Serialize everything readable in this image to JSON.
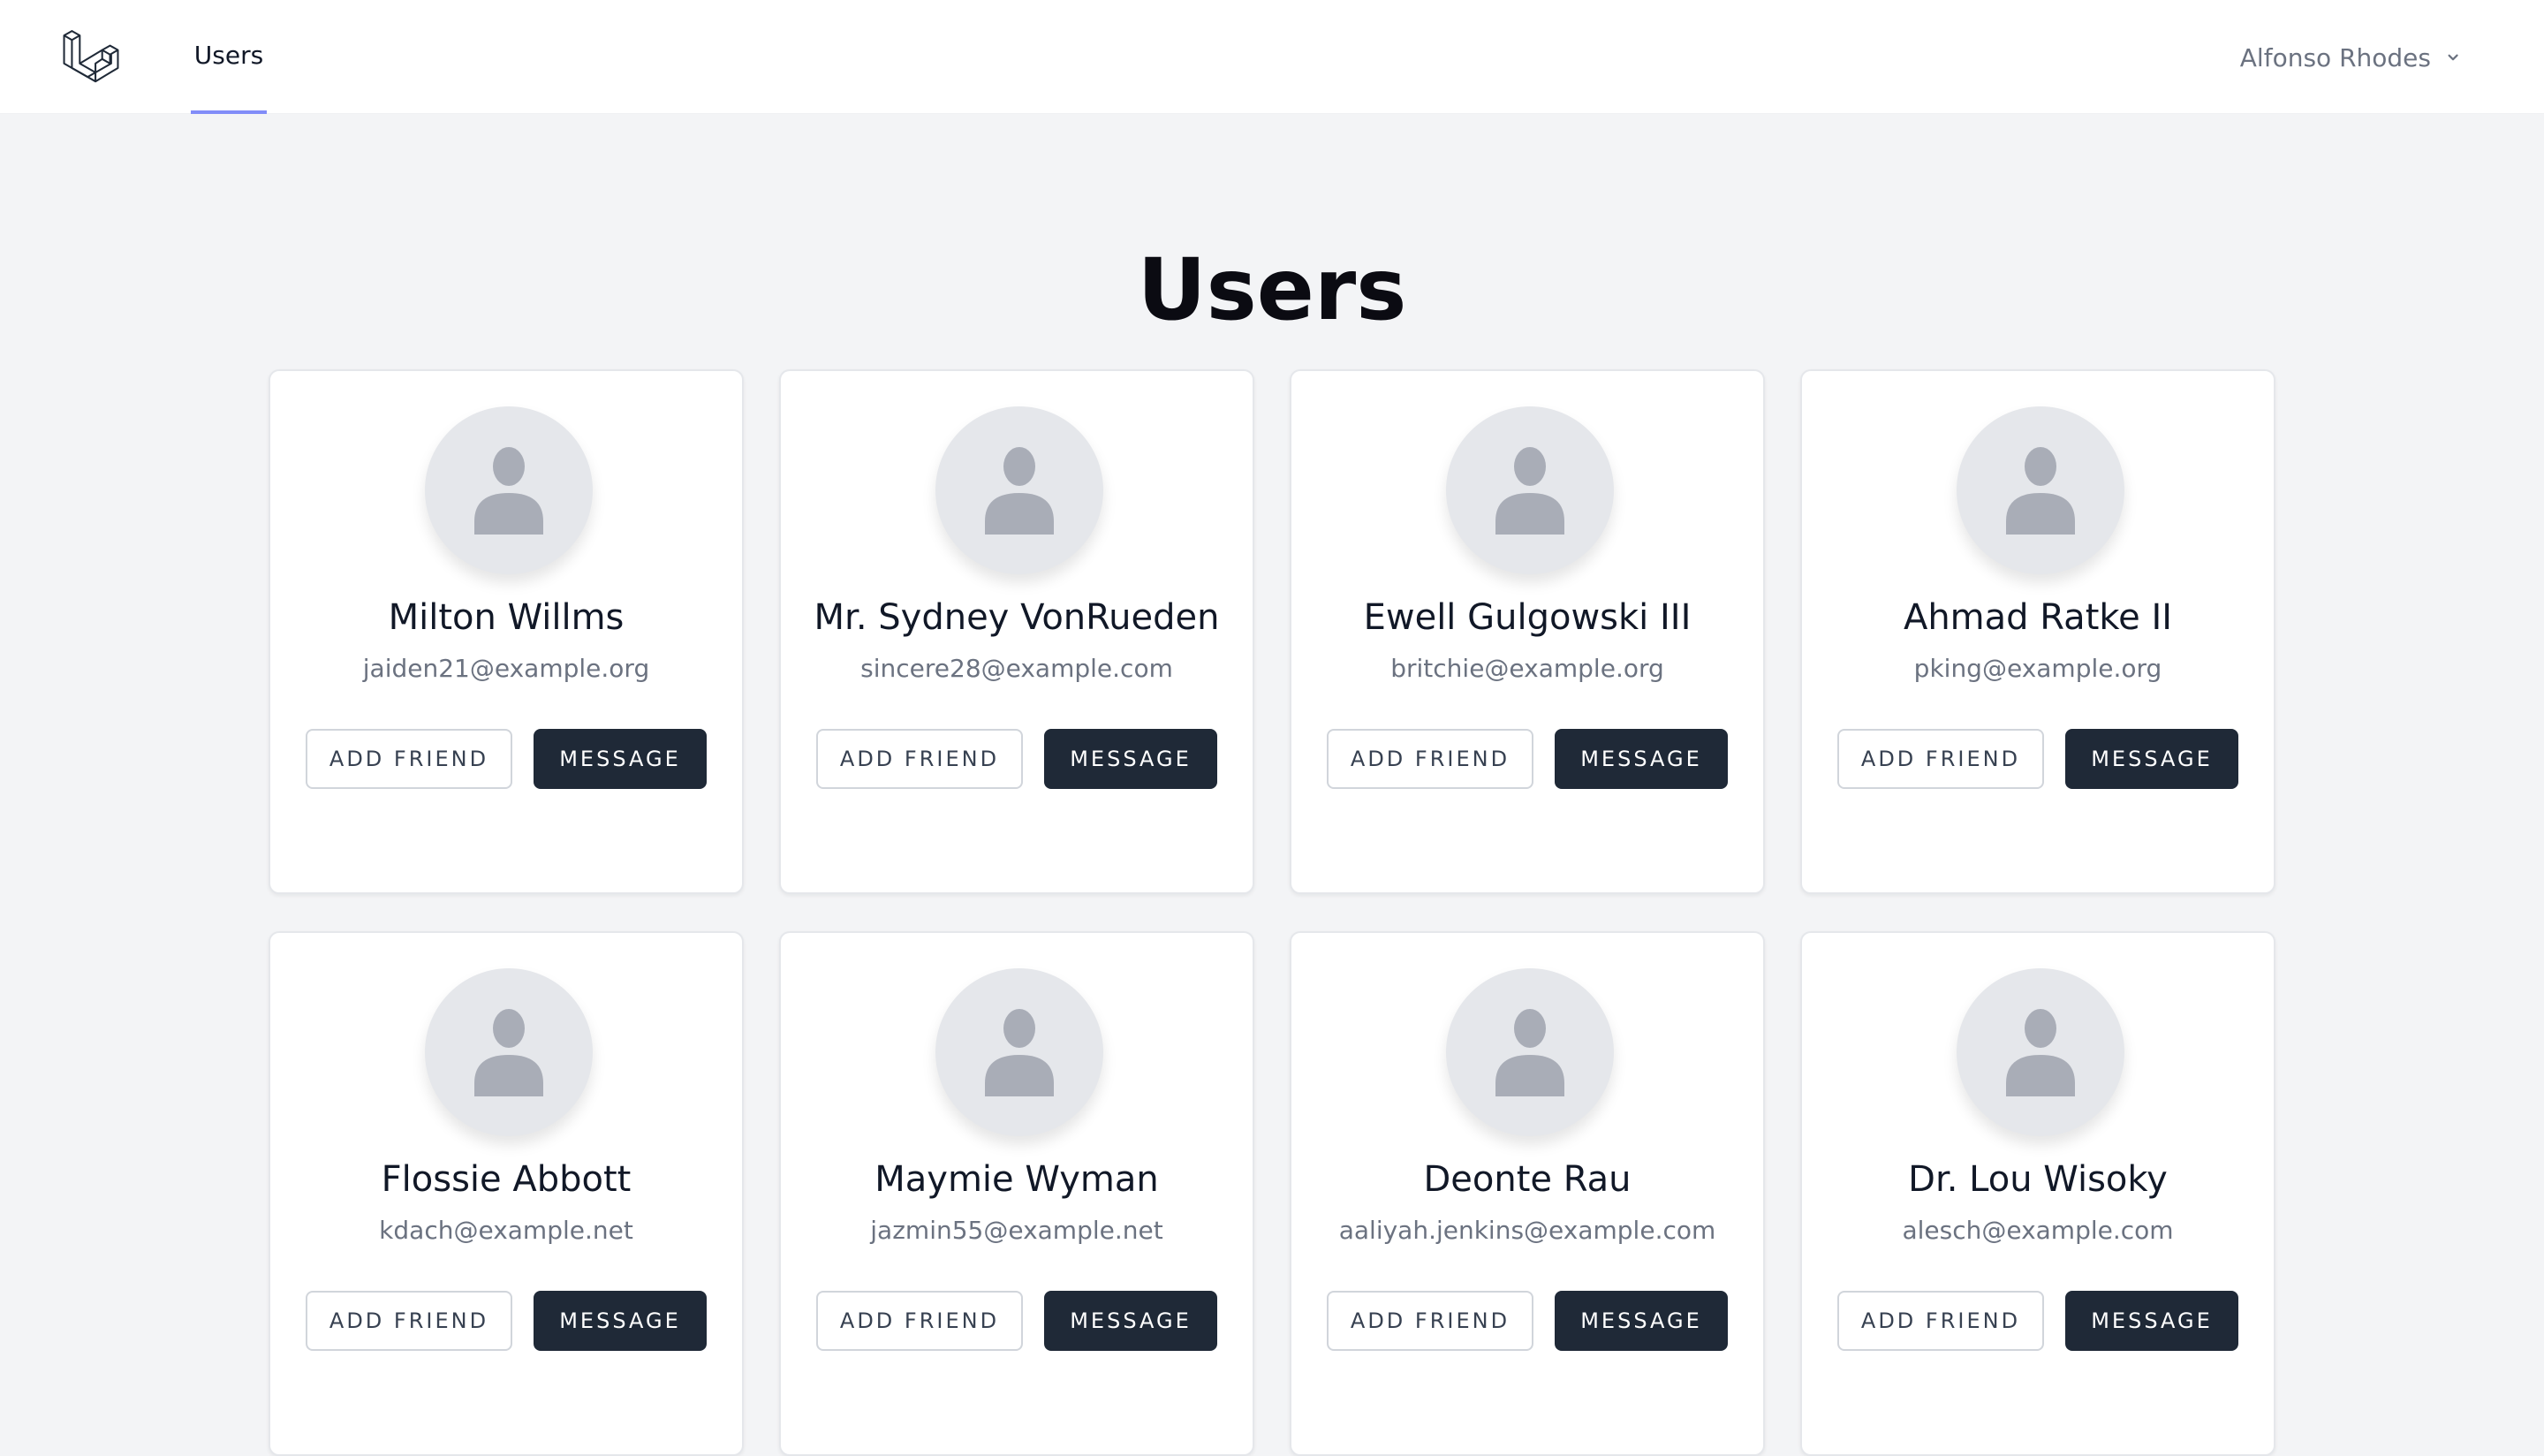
{
  "nav": {
    "links": [
      {
        "label": "Users"
      }
    ],
    "user_name": "Alfonso Rhodes"
  },
  "page": {
    "title": "Users"
  },
  "users": [
    {
      "name": "Milton Willms",
      "email": "jaiden21@example.org",
      "add_label": "ADD FRIEND",
      "message_label": "MESSAGE"
    },
    {
      "name": "Mr. Sydney VonRueden",
      "email": "sincere28@example.com",
      "add_label": "ADD FRIEND",
      "message_label": "MESSAGE"
    },
    {
      "name": "Ewell Gulgowski III",
      "email": "britchie@example.org",
      "add_label": "ADD FRIEND",
      "message_label": "MESSAGE"
    },
    {
      "name": "Ahmad Ratke II",
      "email": "pking@example.org",
      "add_label": "ADD FRIEND",
      "message_label": "MESSAGE"
    },
    {
      "name": "Flossie Abbott",
      "email": "kdach@example.net",
      "add_label": "ADD FRIEND",
      "message_label": "MESSAGE"
    },
    {
      "name": "Maymie Wyman",
      "email": "jazmin55@example.net",
      "add_label": "ADD FRIEND",
      "message_label": "MESSAGE"
    },
    {
      "name": "Deonte Rau",
      "email": "aaliyah.jenkins@example.com",
      "add_label": "ADD FRIEND",
      "message_label": "MESSAGE"
    },
    {
      "name": "Dr. Lou Wisoky",
      "email": "alesch@example.com",
      "add_label": "ADD FRIEND",
      "message_label": "MESSAGE"
    }
  ],
  "icons": {
    "logo": "laravel-logo-icon",
    "user_menu": "chevron-down-icon",
    "avatar": "user-placeholder-icon"
  },
  "colors": {
    "accent": "#818cf8",
    "button_dark": "#1f2937",
    "background": "#f3f4f6"
  }
}
